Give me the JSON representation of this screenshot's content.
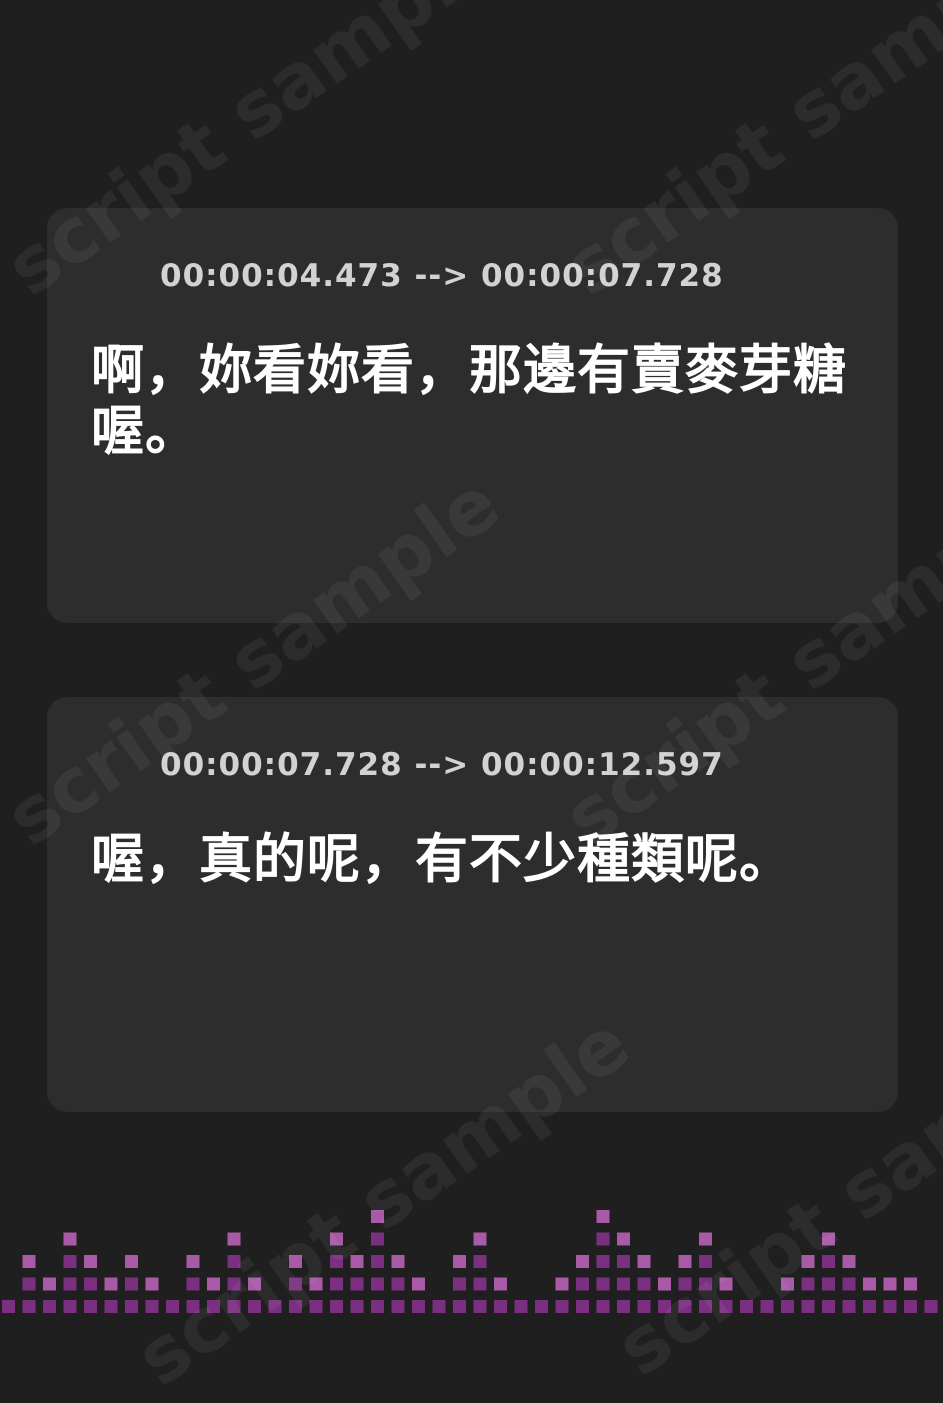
{
  "cues": [
    {
      "timestamp": "00:00:04.473 --> 00:00:07.728",
      "text": "啊，妳看妳看，那邊有賣麥芽糖喔。"
    },
    {
      "timestamp": "00:00:07.728 --> 00:00:12.597",
      "text": "喔，真的呢，有不少種類呢。"
    }
  ],
  "watermark": "script sample",
  "icons": {
    "cue_icon": "audio-wave-icon",
    "footer": "equalizer-bars"
  },
  "colors": {
    "background": "#1f1f1f",
    "card": "#2d2d2d",
    "text": "#ffffff",
    "timestamp": "#d2d2d2",
    "accent_dark": "#7a2f80",
    "accent_light": "#a85aa6",
    "wave_gradient": [
      "#c236c8",
      "#f07ae8"
    ]
  },
  "equalizer_levels": [
    1,
    3,
    2,
    4,
    3,
    2,
    3,
    2,
    1,
    3,
    2,
    4,
    2,
    1,
    3,
    2,
    4,
    3,
    5,
    3,
    2,
    1,
    3,
    4,
    2,
    1,
    1,
    2,
    3,
    5,
    4,
    3,
    2,
    3,
    4,
    2,
    1,
    1,
    2,
    3,
    4,
    3,
    2,
    2,
    2,
    1
  ]
}
